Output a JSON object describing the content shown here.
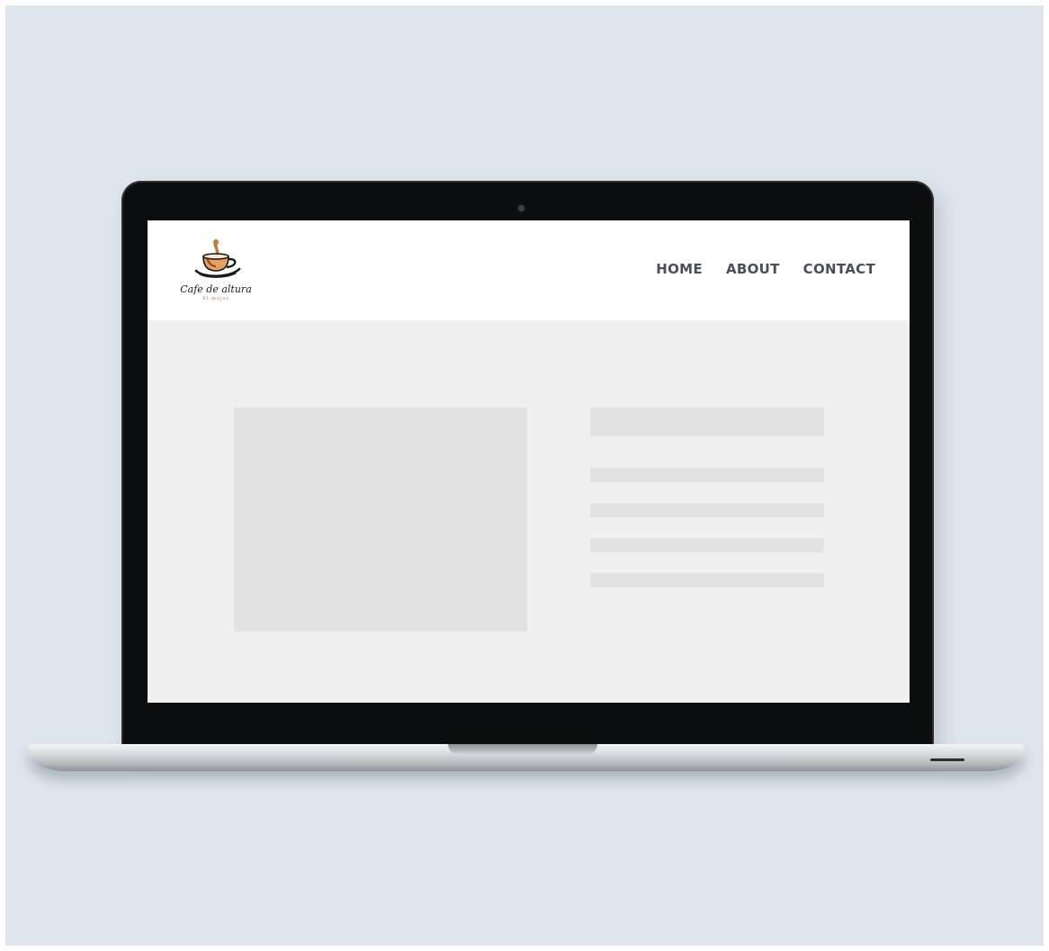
{
  "site": {
    "logo": {
      "name": "Cafe de altura",
      "tagline": "El mejor"
    },
    "nav": {
      "items": [
        {
          "label": "HOME"
        },
        {
          "label": "ABOUT"
        },
        {
          "label": "CONTACT"
        }
      ]
    }
  },
  "colors": {
    "backdrop": "#dfe6ed",
    "screen_bg": "#f0f0f0",
    "placeholder": "#e2e2e2",
    "nav_text": "#4a4f57",
    "logo_accent": "#b86a3a"
  },
  "icons": {
    "logo": "coffee-cup-icon",
    "camera": "camera-icon"
  }
}
